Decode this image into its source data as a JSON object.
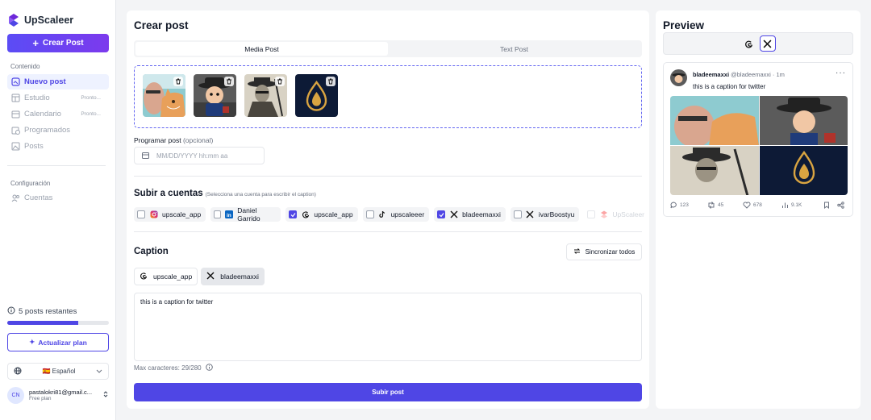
{
  "app": {
    "name": "UpScaleer"
  },
  "sidebar": {
    "create_label": "Crear Post",
    "section_content": "Contenido",
    "items": [
      {
        "label": "Nuevo post",
        "soon": ""
      },
      {
        "label": "Estudio",
        "soon": "Pronto..."
      },
      {
        "label": "Calendario",
        "soon": "Pronto..."
      },
      {
        "label": "Programados",
        "soon": ""
      },
      {
        "label": "Posts",
        "soon": ""
      }
    ],
    "section_config": "Configuración",
    "config_items": [
      {
        "label": "Cuentas"
      }
    ],
    "posts_left": "5 posts restantes",
    "posts_progress": 0.7,
    "upgrade_label": "Actualizar plan",
    "language": "🇪🇸 Español",
    "user": {
      "initials": "CN",
      "email": "pastalokri81@gmail.c...",
      "plan": "Free plan"
    }
  },
  "main": {
    "title": "Crear post",
    "tabs": [
      "Media Post",
      "Text Post"
    ],
    "schedule_label": "Programar post",
    "schedule_optional": "(opcional)",
    "date_placeholder": "MM/DD/YYYY hh:mm aa",
    "accounts_title": "Subir a cuentas",
    "accounts_hint": "(Selecciona una cuenta para escribir el caption)",
    "accounts": [
      {
        "name": "upscale_app",
        "platform": "instagram-icon",
        "checked": false
      },
      {
        "name": "Daniel Garrido",
        "platform": "linkedin-icon",
        "checked": false
      },
      {
        "name": "upscale_app",
        "platform": "threads-icon",
        "checked": true
      },
      {
        "name": "upscaleeer",
        "platform": "tiktok-icon",
        "checked": false
      },
      {
        "name": "bladeemaxxi",
        "platform": "x-icon",
        "checked": true
      },
      {
        "name": "ivarBoostyu",
        "platform": "x-icon",
        "checked": false
      },
      {
        "name": "UpScaleer",
        "platform": "upscaleer-icon",
        "checked": false,
        "disabled": true
      }
    ],
    "caption_title": "Caption",
    "sync_label": "Sincronizar todos",
    "caption_tabs": [
      "upscale_app",
      "bladeemaxxi"
    ],
    "caption_text": "this is a caption for twitter",
    "max_chars": "Max caracteres: 29/280",
    "submit_label": "Subir post"
  },
  "preview": {
    "title": "Preview",
    "tweet": {
      "name": "bladeemaxxi",
      "handle": "@bladeemaxxi · 1m",
      "text": "this is a caption for twitter",
      "replies": "123",
      "retweets": "45",
      "likes": "678",
      "views": "9.1K"
    }
  },
  "colors": {
    "accent": "#4f46e5",
    "accent2": "#7c3aed"
  }
}
